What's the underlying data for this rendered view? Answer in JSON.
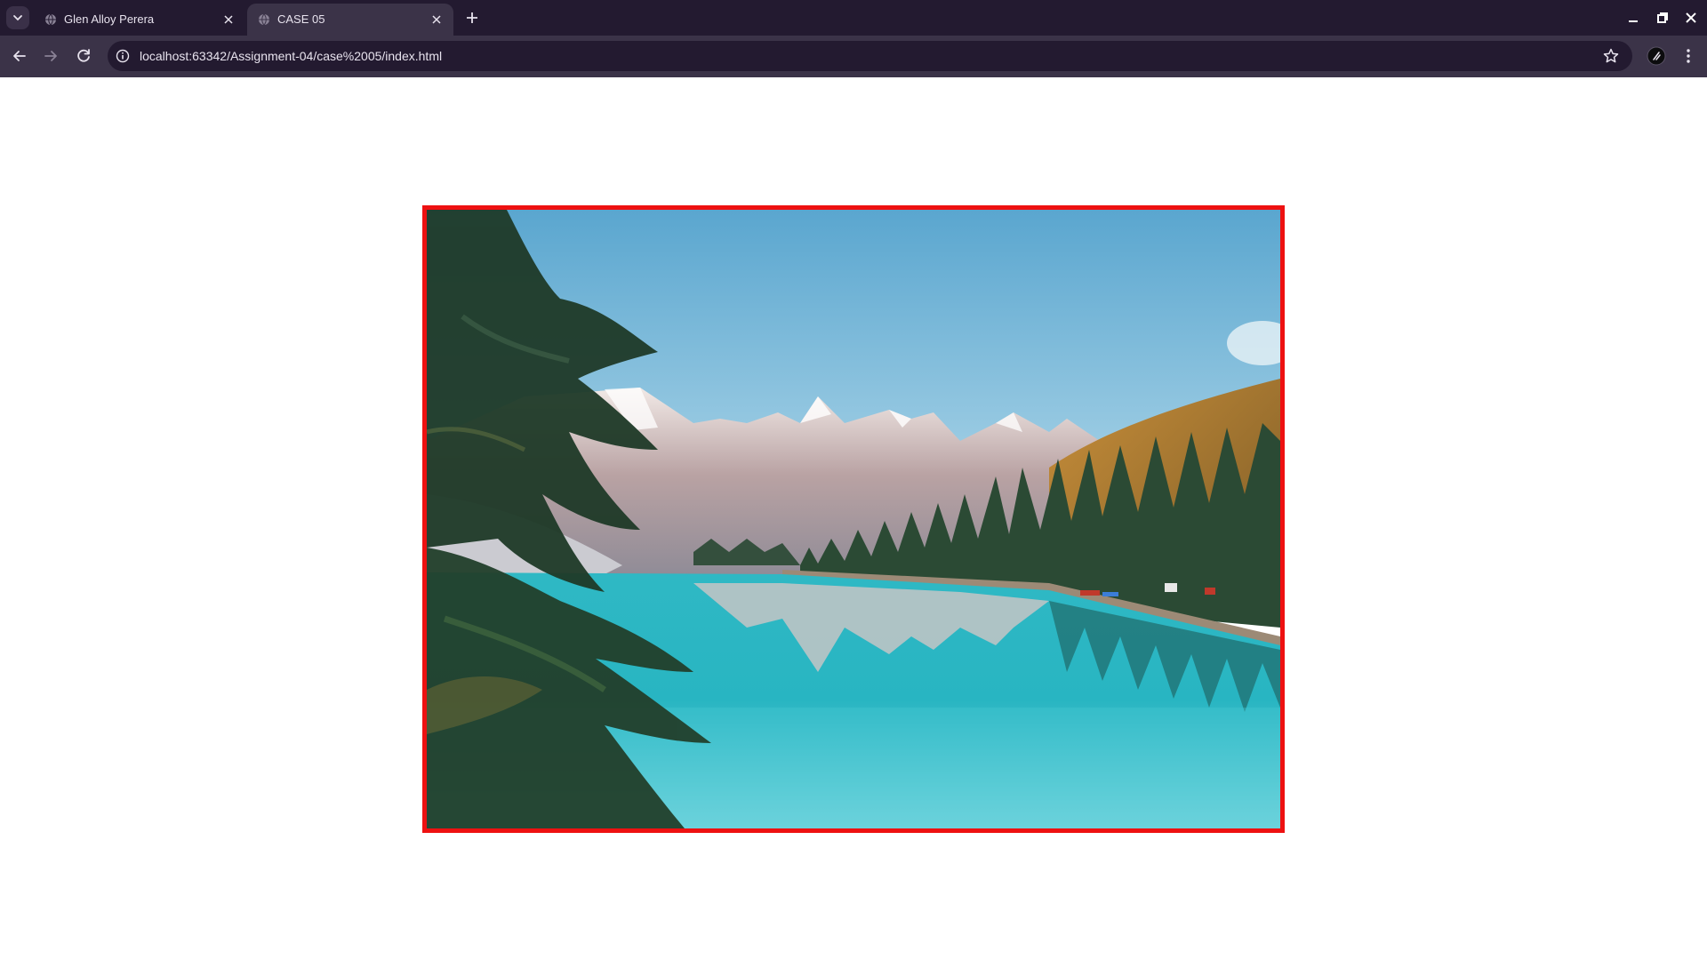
{
  "browser": {
    "tabs": [
      {
        "title": "Glen Alloy Perera",
        "active": false,
        "favicon": "globe-icon"
      },
      {
        "title": "CASE 05",
        "active": true,
        "favicon": "globe-icon"
      }
    ],
    "url": "localhost:63342/Assignment-04/case%2005/index.html",
    "colors": {
      "frame": "#231a30",
      "toolbar": "#3b3348",
      "text": "#e8e3ee"
    }
  },
  "page": {
    "image": {
      "description_type": "landscape-photo",
      "border_color": "#ee1111"
    }
  }
}
